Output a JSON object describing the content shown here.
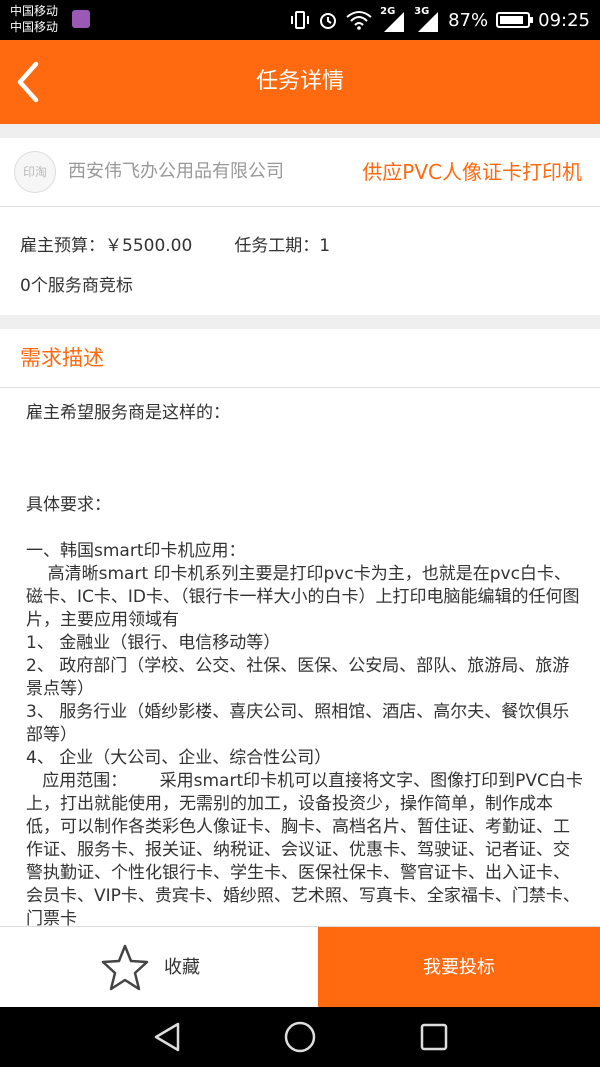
{
  "status_bar": {
    "carrier1": "中国移动",
    "carrier2": "中国移动",
    "network1": "2G",
    "network2": "3G",
    "battery": "87%",
    "battery_level": 0.87,
    "time": "09:25"
  },
  "header": {
    "title": "任务详情"
  },
  "company": {
    "logo_text": "印淘",
    "name": "西安伟飞办公用品有限公司",
    "task_title": "供应PVC人像证卡打印机"
  },
  "info": {
    "budget": "雇主预算：￥5500.00",
    "period": "任务工期：1",
    "bidders": "0个服务商竞标"
  },
  "description": {
    "section_title": "需求描述",
    "body": "雇主希望服务商是这样的：\n\n\n\n具体要求：\n\n一、韩国smart印卡机应用：\n    高清晰smart 印卡机系列主要是打印pvc卡为主，也就是在pvc白卡、磁卡、IC卡、ID卡、（银行卡一样大小的白卡）上打印电脑能编辑的任何图片，主要应用领域有\n1、 金融业（银行、电信移动等）\n2、 政府部门（学校、公交、社保、医保、公安局、部队、旅游局、旅游景点等）\n3、 服务行业（婚纱影楼、喜庆公司、照相馆、酒店、高尔夫、餐饮俱乐部等）\n4、 企业（大公司、企业、综合性公司）\n   应用范围：      采用smart印卡机可以直接将文字、图像打印到PVC白卡上，打出就能使用，无需别的加工，设备投资少，操作简单，制作成本低，可以制作各类彩色人像证卡、胸卡、高档名片、暂住证、考勤证、工作证、服务卡、报关证、纳税证、会议证、优惠卡、驾驶证、记者证、交警执勤证、个性化银行卡、学生卡、医保社保卡、警官证卡、出入证卡、会员卡、VIP卡、贵宾卡、婚纱照、艺术照、写真卡、全家福卡、门禁卡、门票卡"
  },
  "bottom_bar": {
    "favorite_label": "收藏",
    "bid_label": "我要投标"
  },
  "colors": {
    "accent": "#ff6a10",
    "statusbar": "#000000"
  },
  "icons": {
    "back": "chevron-left-icon",
    "favorite": "star-icon",
    "nav_back": "triangle-back-icon",
    "nav_home": "circle-home-icon",
    "nav_recent": "square-recent-icon"
  }
}
